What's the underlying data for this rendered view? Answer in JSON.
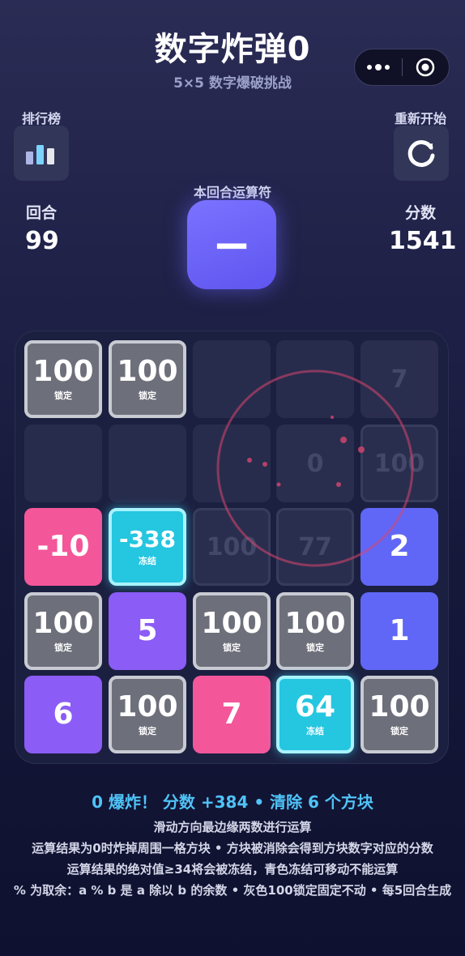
{
  "header": {
    "title": "数字炸弹0",
    "subtitle": "5×5 数字爆破挑战"
  },
  "leaderboard": {
    "label": "排行榜",
    "icon": "bar-chart-icon"
  },
  "restart": {
    "label": "重新开始",
    "icon": "refresh-icon"
  },
  "round": {
    "label": "回合",
    "value": "99"
  },
  "score": {
    "label": "分数",
    "value": "1541"
  },
  "operator": {
    "label": "本回合运算符",
    "symbol": "−"
  },
  "board": {
    "rows": [
      [
        {
          "num": "100",
          "sub": "锁定"
        },
        {
          "num": "100",
          "sub": "锁定"
        },
        {
          "num": "",
          "sub": ""
        },
        {
          "num": "",
          "sub": ""
        },
        {
          "num": "",
          "sub": ""
        }
      ],
      [
        {
          "num": "",
          "sub": ""
        },
        {
          "num": "",
          "sub": ""
        },
        {
          "num": "",
          "sub": ""
        },
        {
          "num": "",
          "sub": ""
        },
        {
          "num": "",
          "sub": ""
        }
      ],
      [
        {
          "num": "-10",
          "sub": ""
        },
        {
          "num": "-338",
          "sub": "冻结"
        },
        {
          "num": "",
          "sub": ""
        },
        {
          "num": "",
          "sub": ""
        },
        {
          "num": "2",
          "sub": ""
        }
      ],
      [
        {
          "num": "100",
          "sub": "锁定"
        },
        {
          "num": "5",
          "sub": ""
        },
        {
          "num": "100",
          "sub": "锁定"
        },
        {
          "num": "100",
          "sub": "锁定"
        },
        {
          "num": "1",
          "sub": ""
        }
      ],
      [
        {
          "num": "6",
          "sub": ""
        },
        {
          "num": "100",
          "sub": "锁定"
        },
        {
          "num": "7",
          "sub": ""
        },
        {
          "num": "64",
          "sub": "冻结"
        },
        {
          "num": "100",
          "sub": "锁定"
        }
      ]
    ],
    "ghosts": [
      {
        "num": "7",
        "sub": ""
      },
      {
        "num": "0",
        "sub": ""
      },
      {
        "num": "100",
        "sub": ""
      },
      {
        "num": "100",
        "sub": ""
      },
      {
        "num": "77",
        "sub": ""
      }
    ]
  },
  "message": "0 爆炸！ 分数 +384 • 清除 6 个方块",
  "rules": [
    "滑动方向最边缘两数进行运算",
    "运算结果为0时炸掉周围一格方块 • 方块被消除会得到方块数字对应的分数",
    "运算结果的绝对值≥34将会被冻结，青色冻结可移动不能运算",
    "% 为取余：a % b 是 a 除以 b 的余数 • 灰色100锁定固定不动 • 每5回合生成"
  ],
  "colors": {
    "accent": "#6b63f8",
    "locked": "#6d6f7a",
    "frozen": "#25c6e0",
    "pink": "#f4569a",
    "purple": "#8b5cf6",
    "blue": "#6067f6",
    "message": "#4fc3f7"
  }
}
